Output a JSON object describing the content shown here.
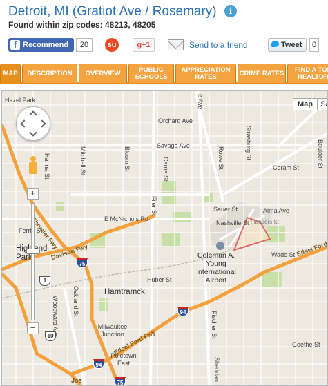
{
  "header": {
    "title": "Detroit, MI (Gratiot Ave / Rosemary)",
    "info_icon": "i",
    "zip_line": "Found within zip codes: 48213, 48205"
  },
  "social": {
    "recommend_label": "Recommend",
    "recommend_count": "20",
    "stumble_glyph": "su",
    "gplus_label": "g+1",
    "send_friend": "Send to a friend",
    "tweet_label": "Tweet",
    "tweet_count": "0"
  },
  "tabs": [
    {
      "label": "MAP",
      "active": true
    },
    {
      "label": "DESCRIPTION",
      "active": false
    },
    {
      "label": "OVERVIEW",
      "active": false
    },
    {
      "label": "PUBLIC SCHOOLS",
      "active": false
    },
    {
      "label": "APPRECIATION RATES",
      "active": false
    },
    {
      "label": "CRIME RATES",
      "active": false
    },
    {
      "label": "FIND A TOP REALTOR",
      "active": false
    }
  ],
  "map": {
    "type_buttons": [
      "Map",
      "Sa"
    ],
    "zoom_in": "+",
    "zoom_out": "−",
    "street_labels": {
      "hazel_park": "Hazel Park",
      "orchard_ave": "Orchard Ave",
      "savage_ave": "Savage Ave",
      "coram_st": "Coram St",
      "sauer_st": "Sauer St",
      "alma_ave": "Alma Ave",
      "nashville_st": "Nashville St",
      "flanders_st": "Flanders St",
      "mcnichols": "E McNichols Rd",
      "ferris_st": "Ferris St",
      "highland_park": "Highland Park",
      "davison_fwy": "Davison Fwy",
      "chrysler_fwy": "Chrysler Fwy",
      "airport": "Coleman A. Young International Airport",
      "wade_st": "Wade St",
      "edsel_ford_fwy_e": "Edsel Ford Fwy",
      "edsel_ford_fwy_s": "Edsel Ford Fwy",
      "huber_st": "Huber St",
      "hamtramck": "Hamtramck",
      "milwaukee_junction": "Milwaukee Junction",
      "poletown_east": "Poletown East",
      "goethe_st": "Goethe St",
      "hanna_st": "Hanna St",
      "mitchell_st": "Mitchell St",
      "bloom_st": "Bloom St",
      "carrie_st": "Carrie St",
      "filer_st": "Filer St",
      "rowe_st": "Rowe St",
      "strasburg_st": "Strasburg St",
      "boulder_st": "Boulder St",
      "woodward_ave": "Woodward Ave",
      "oakland_st": "Oakland St",
      "fischer_st": "Fischer St",
      "sheridan": "Sheridan",
      "jos": "Jos",
      "e_ave": "e Ave"
    },
    "shields": {
      "i75_north": "75",
      "i75_south": "75",
      "i94_a": "94",
      "i94_b": "94",
      "m1": "1",
      "m10": "10"
    },
    "colors": {
      "freeway": "#f2a13d",
      "major_road": "#ffffff",
      "park": "#c9dfa8",
      "boundary": "#e06b6b",
      "water": "#a8c8e8"
    }
  }
}
